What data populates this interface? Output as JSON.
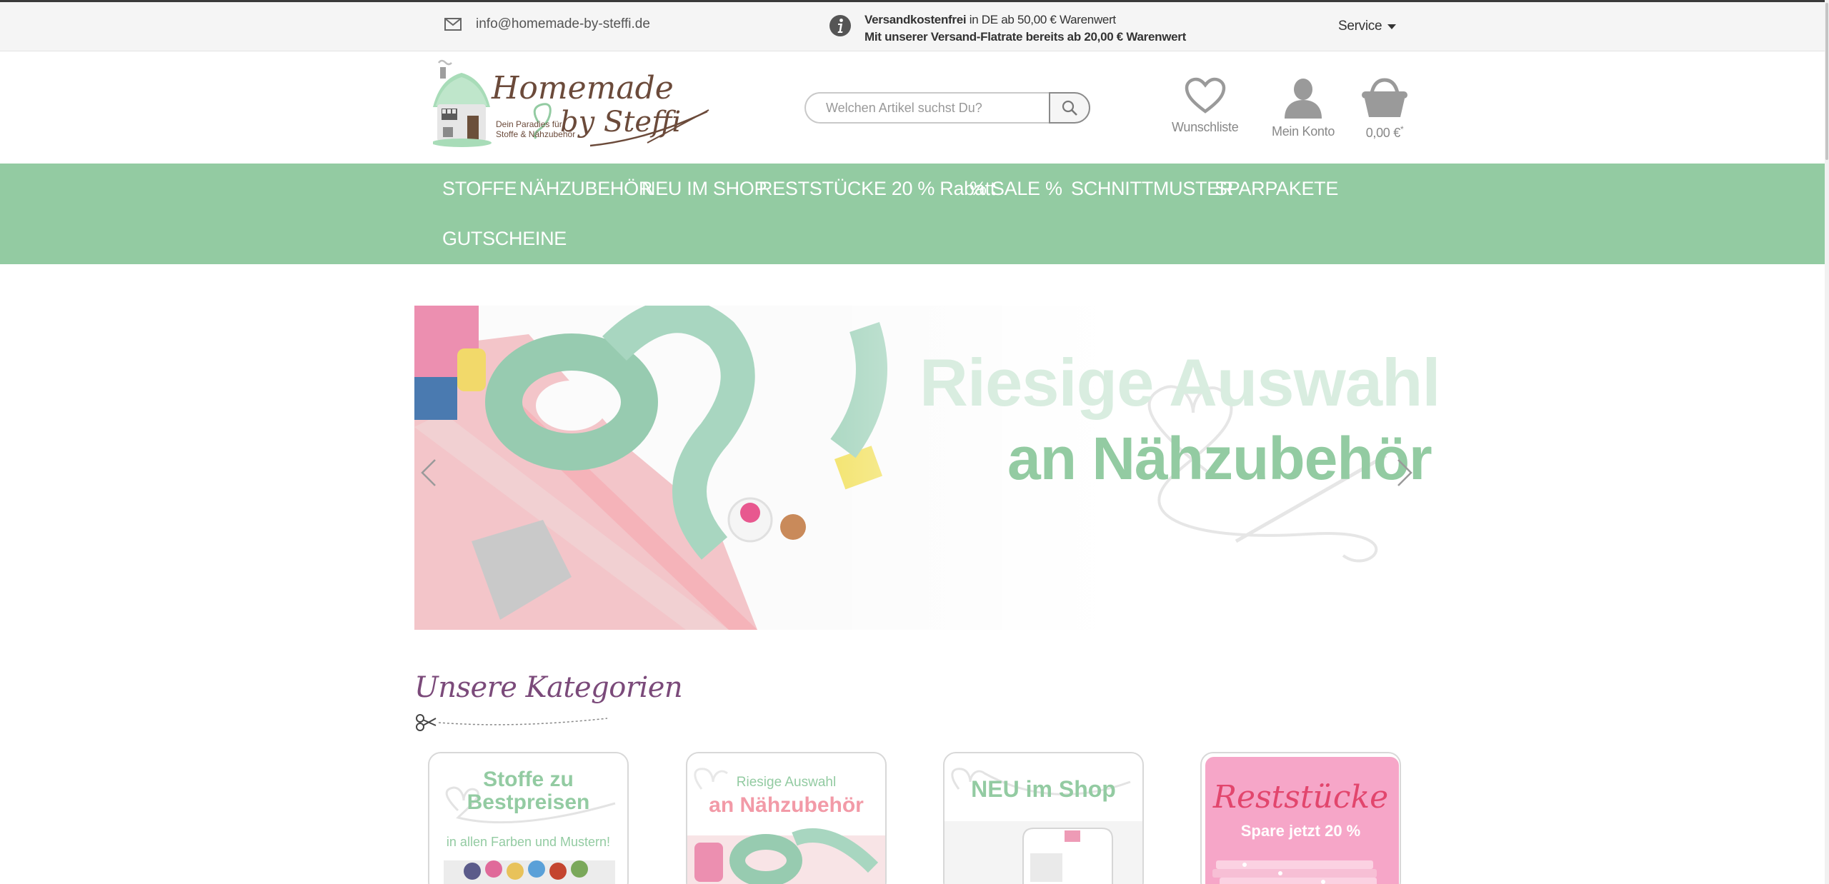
{
  "topbar": {
    "email": "info@homemade-by-steffi.de",
    "shipping_bold": "Versandkostenfrei",
    "shipping_rest": " in DE ab 50,00 € Warenwert",
    "shipping_line2": "Mit unserer Versand-Flatrate bereits ab 20,00 € Warenwert",
    "service_label": "Service",
    "icons": {
      "mail": "mail-icon",
      "info": "info-icon",
      "caret": "chevron-down-icon"
    }
  },
  "logo": {
    "name": "Homemade by Steffi",
    "tagline_line1": "Dein Paradies für",
    "tagline_line2": "Stoffe & Nähzubehör"
  },
  "search": {
    "placeholder": "Welchen Artikel suchst Du?",
    "icon": "search-icon"
  },
  "header_actions": {
    "wishlist": {
      "label": "Wunschliste",
      "icon": "heart-icon"
    },
    "account": {
      "label": "Mein Konto",
      "icon": "user-icon"
    },
    "cart": {
      "label": "0,00 €",
      "suffix": "*",
      "icon": "basket-icon"
    }
  },
  "nav": {
    "items": [
      {
        "label": "STOFFE"
      },
      {
        "label": "NÄHZUBEHÖR"
      },
      {
        "label": "NEU IM SHOP"
      },
      {
        "label": "RESTSTÜCKE 20 % Rabatt"
      },
      {
        "label": "% SALE %"
      },
      {
        "label": "SCHNITTMUSTER"
      },
      {
        "label": "SPARPAKETE"
      },
      {
        "label": "GUTSCHEINE"
      }
    ]
  },
  "slider": {
    "title_line1": "Riesige Auswahl",
    "title_line2": "an Nähzubehör",
    "prev_icon": "chevron-left-icon",
    "next_icon": "chevron-right-icon"
  },
  "categories": {
    "heading": "Unsere Kategorien",
    "cards": [
      {
        "line1": "Stoffe zu",
        "line2": "Bestpreisen",
        "line3": "in allen Farben und Mustern!"
      },
      {
        "line1": "Riesige Auswahl",
        "line2": "an Nähzubehör"
      },
      {
        "line1": "NEU im Shop"
      },
      {
        "line1": "Reststücke",
        "line2": "Spare jetzt 20 %"
      }
    ]
  },
  "colors": {
    "brand_green": "#93cba2",
    "heading_purple": "#7b4a7a",
    "reststuecke_pink": "#f6a6c8"
  }
}
